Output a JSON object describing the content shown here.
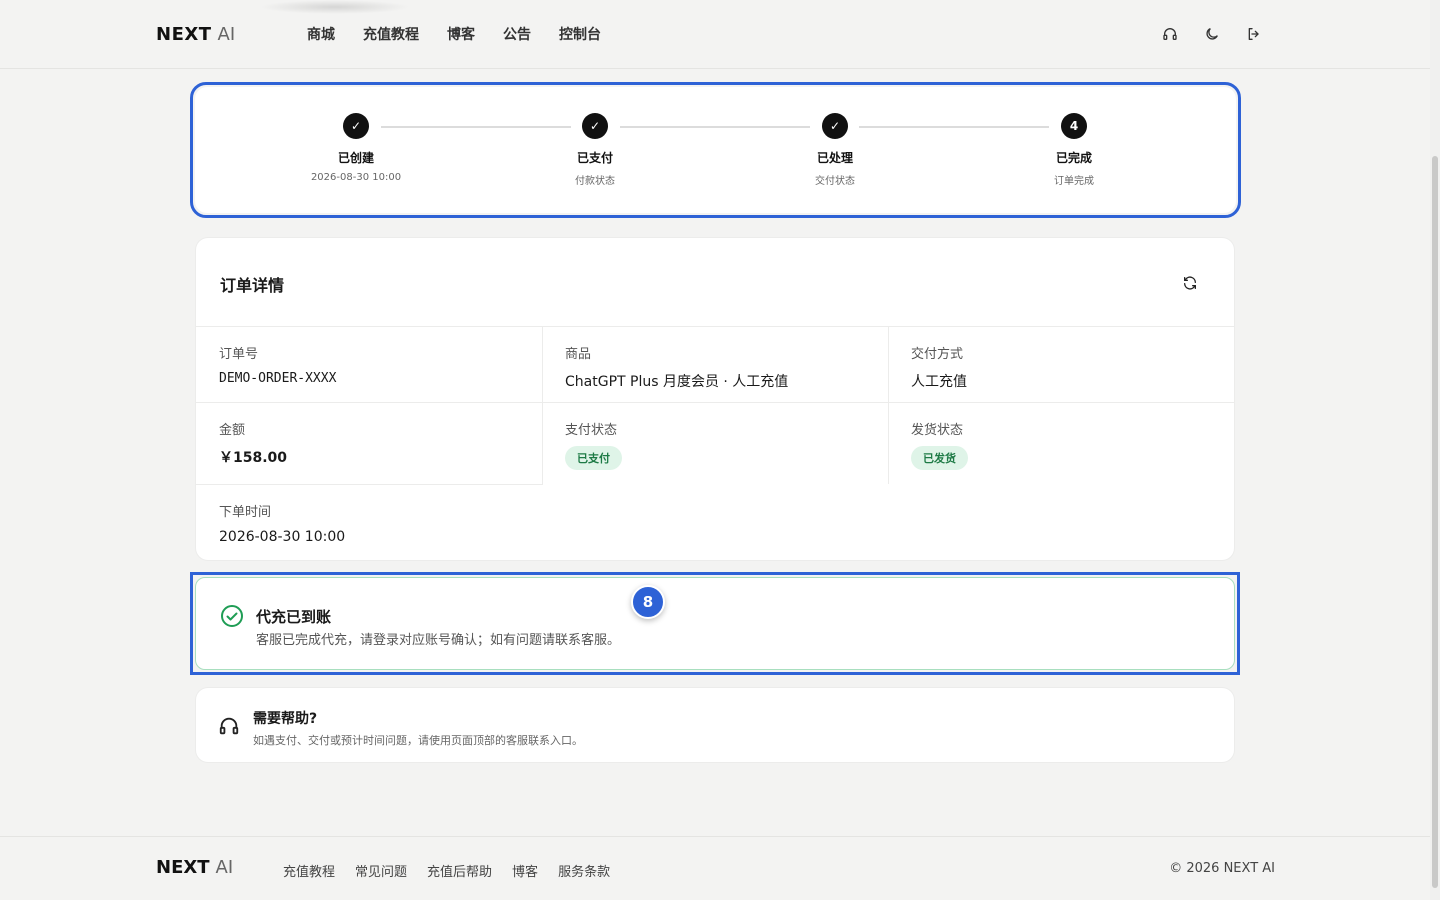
{
  "header": {
    "logo_brand": "NEXT",
    "logo_ai": "AI",
    "nav": [
      "商城",
      "充值教程",
      "博客",
      "公告",
      "控制台"
    ]
  },
  "progress": {
    "steps": [
      {
        "marker": "✓",
        "title": "已创建",
        "sub": "2026-08-30 10:00"
      },
      {
        "marker": "✓",
        "title": "已支付",
        "sub": "付款状态"
      },
      {
        "marker": "✓",
        "title": "已处理",
        "sub": "交付状态"
      },
      {
        "marker": "4",
        "title": "已完成",
        "sub": "订单完成"
      }
    ]
  },
  "order": {
    "title": "订单详情",
    "order_no_label": "订单号",
    "order_no": "DEMO-ORDER-XXXX",
    "product_label": "商品",
    "product": "ChatGPT Plus 月度会员 · 人工充值",
    "delivery_method_label": "交付方式",
    "delivery_method": "人工充值",
    "amount_label": "金额",
    "amount": "￥158.00",
    "pay_status_label": "支付状态",
    "pay_status": "已支付",
    "ship_status_label": "发货状态",
    "ship_status": "已发货",
    "order_time_label": "下单时间",
    "order_time": "2026-08-30 10:00"
  },
  "success": {
    "title": "代充已到账",
    "desc": "客服已完成代充，请登录对应账号确认；如有问题请联系客服。",
    "badge": "8"
  },
  "help": {
    "title": "需要帮助?",
    "desc": "如遇支付、交付或预计时间问题，请使用页面顶部的客服联系入口。"
  },
  "footer": {
    "logo_brand": "NEXT",
    "logo_ai": "AI",
    "links": [
      "充值教程",
      "常见问题",
      "充值后帮助",
      "博客",
      "服务条款"
    ],
    "copyright": "© 2026 NEXT AI"
  },
  "colors": {
    "accent_highlight": "#2e62d6",
    "success_green": "#1d7a45",
    "badge_bg": "#dff4e8"
  },
  "icons": [
    "headset-icon",
    "moon-icon",
    "logout-icon",
    "refresh-icon",
    "check-circle-icon"
  ]
}
